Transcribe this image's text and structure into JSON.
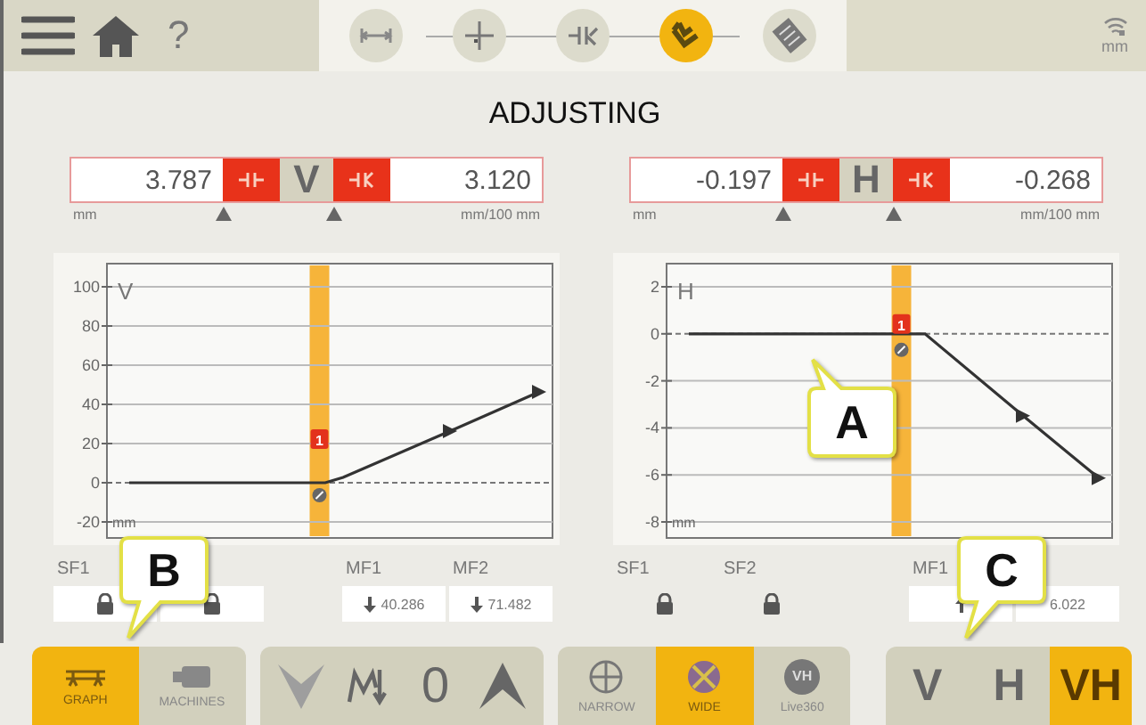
{
  "top_bar": {
    "help": "?",
    "units": "mm",
    "steps": [
      {
        "kind": "distance",
        "selected": false
      },
      {
        "kind": "measure",
        "selected": false
      },
      {
        "kind": "tolerance",
        "selected": false
      },
      {
        "kind": "adjust",
        "selected": true
      },
      {
        "kind": "report",
        "selected": false
      }
    ]
  },
  "title": "ADJUSTING",
  "panels": [
    {
      "axis": "V",
      "offset": {
        "value": "3.787",
        "unit": "mm",
        "out_of_tolerance": true
      },
      "angle": {
        "value": "3.120",
        "unit": "mm/100 mm",
        "out_of_tolerance": true
      },
      "badge": "1",
      "plot": {
        "title": "V",
        "unit": "mm",
        "tick_labels": [
          "100",
          "80",
          "60",
          "40",
          "20",
          "0",
          "-20"
        ]
      },
      "feet": [
        {
          "label": "SF1",
          "locked": true
        },
        {
          "locked": true
        },
        {
          "label": "MF1",
          "kind": "down",
          "value": "40.286"
        },
        {
          "label": "MF2",
          "kind": "down",
          "value": "71.482"
        }
      ]
    },
    {
      "axis": "H",
      "offset": {
        "value": "-0.197",
        "unit": "mm",
        "out_of_tolerance": true
      },
      "angle": {
        "value": "-0.268",
        "unit": "mm/100 mm",
        "out_of_tolerance": true
      },
      "badge": "1",
      "plot": {
        "title": "H",
        "unit": "mm",
        "tick_labels": [
          "2",
          "0",
          "-2",
          "-4",
          "-6",
          "-8"
        ]
      },
      "feet": [
        {
          "label": "SF1",
          "locked": true
        },
        {
          "label": "SF2",
          "locked": true
        },
        {
          "label": "MF1",
          "kind": "up"
        },
        {
          "value": "6.022"
        }
      ]
    }
  ],
  "bottom_bar": {
    "views": [
      {
        "kind": "graph",
        "label": "GRAPH",
        "selected": true
      },
      {
        "kind": "machines",
        "label": "MACHINES",
        "selected": false
      }
    ],
    "moves": [
      {
        "kind": "down",
        "disabled": true
      },
      {
        "kind": "shim",
        "disabled": false
      },
      {
        "kind": "zero",
        "label": "0",
        "disabled": false
      },
      {
        "kind": "up",
        "disabled": false
      }
    ],
    "modes": [
      {
        "kind": "narrow",
        "label": "NARROW",
        "selected": false
      },
      {
        "kind": "wide",
        "label": "WIDE",
        "selected": true
      },
      {
        "kind": "live",
        "label": "Live360",
        "icon_text": "VH",
        "selected": false
      }
    ],
    "axes": [
      {
        "label": "V",
        "selected": false
      },
      {
        "label": "H",
        "selected": false
      },
      {
        "label": "VH",
        "selected": true
      }
    ]
  },
  "callouts": [
    {
      "label": "A"
    },
    {
      "label": "B"
    },
    {
      "label": "C"
    }
  ]
}
